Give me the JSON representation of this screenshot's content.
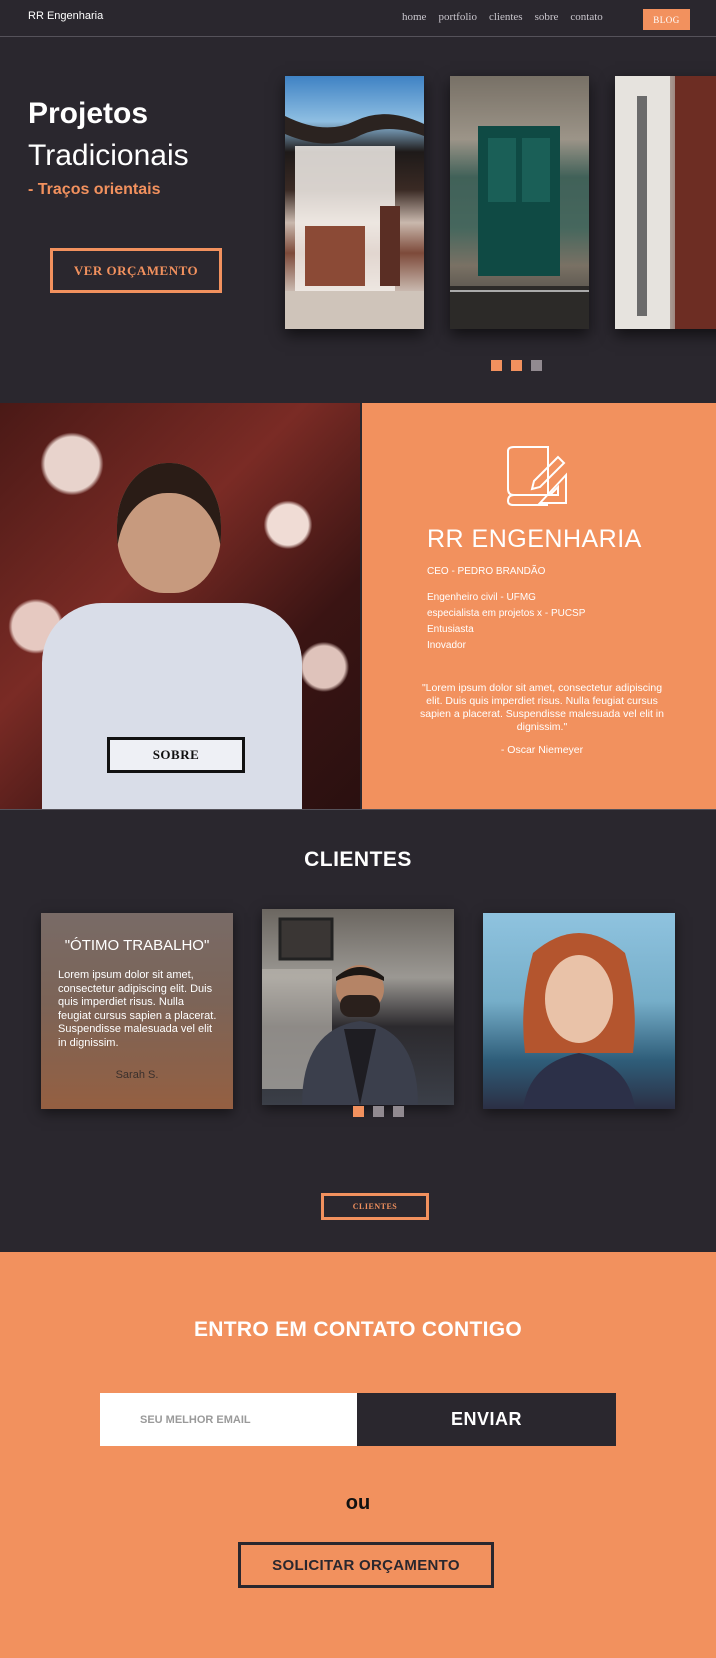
{
  "nav": {
    "brand": "RR Engenharia",
    "links": [
      "home",
      "portfolio",
      "clientes",
      "sobre",
      "contato"
    ],
    "blog_label": "BLOG"
  },
  "hero": {
    "title_line1": "Projetos",
    "title_line2": "Tradicionais",
    "subtitle": "- Traços orientais",
    "cta_label": "VER ORÇAMENTO",
    "active_slide": 2,
    "slide_count": 3
  },
  "about": {
    "button_label": "SOBRE",
    "company": "RR ENGENHARIA",
    "ceo": "CEO - PEDRO BRANDÃO",
    "credentials": [
      "Engenheiro civil - UFMG",
      "especialista em projetos x - PUCSP",
      "Entusiasta",
      "Inovador"
    ],
    "quote": "\"Lorem ipsum dolor sit amet, consectetur adipiscing elit. Duis quis imperdiet risus. Nulla feugiat cursus sapien a placerat. Suspendisse malesuada vel elit in dignissim.\"",
    "quote_author": "- Oscar Niemeyer"
  },
  "clients": {
    "title": "CLIENTES",
    "testimonial_title": "\"ÓTIMO TRABALHO\"",
    "testimonial_text": "Lorem ipsum dolor sit amet, consectetur adipiscing elit. Duis quis imperdiet risus. Nulla feugiat cursus sapien a placerat. Suspendisse malesuada vel elit in dignissim.",
    "testimonial_name": "Sarah S.",
    "button_label": "CLIENTES",
    "active_slide": 1,
    "slide_count": 3
  },
  "contact": {
    "title": "ENTRO EM CONTATO CONTIGO",
    "email_placeholder": "SEU MELHOR EMAIL",
    "send_label": "ENVIAR",
    "or_label": "ou",
    "request_label": "SOLICITAR ORÇAMENTO"
  },
  "colors": {
    "accent": "#f2915e",
    "dark": "#2a272e",
    "inactive_dot": "#918a90"
  },
  "icons": [
    "blueprint-icon"
  ]
}
